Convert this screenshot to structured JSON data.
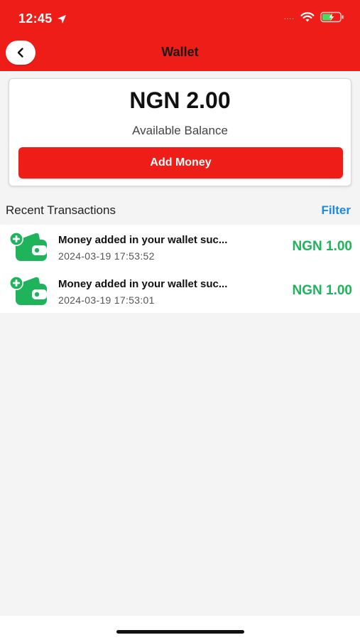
{
  "status_bar": {
    "time": "12:45",
    "signal": "....",
    "icons": [
      "location-arrow-icon",
      "wifi-icon",
      "battery-charging-icon"
    ]
  },
  "header": {
    "title": "Wallet",
    "back_icon": "chevron-left-icon"
  },
  "balance": {
    "amount": "NGN 2.00",
    "label": "Available Balance",
    "add_money_label": "Add Money"
  },
  "transactions": {
    "section_title": "Recent Transactions",
    "filter_label": "Filter",
    "items": [
      {
        "title": "Money added in your wallet suc...",
        "date": "2024-03-19 17:53:52",
        "amount": "NGN 1.00",
        "icon": "wallet-add-icon"
      },
      {
        "title": "Money added in your wallet suc...",
        "date": "2024-03-19 17:53:01",
        "amount": "NGN 1.00",
        "icon": "wallet-add-icon"
      }
    ]
  },
  "colors": {
    "brand_red": "#ee1d17",
    "credit_green": "#1fb45c",
    "link_blue": "#1e88e5"
  }
}
